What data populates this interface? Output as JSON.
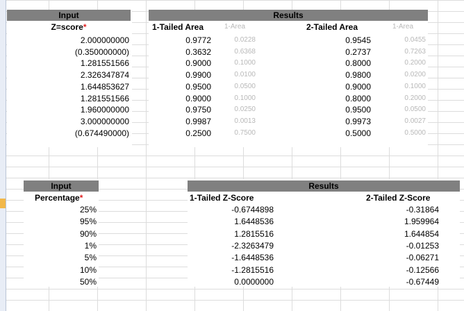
{
  "top": {
    "input_header": "Input",
    "results_header": "Results",
    "z_label": "Z=score",
    "one_tailed_label": "1-Tailed Area",
    "one_minus_label": "1-Area",
    "two_tailed_label": "2-Tailed Area",
    "two_minus_label": "1-Area",
    "required_mark": "*",
    "rows": [
      {
        "z": "2.000000000",
        "a1": "0.9772",
        "m1": "0.0228",
        "a2": "0.9545",
        "m2": "0.0455"
      },
      {
        "z": "(0.350000000)",
        "a1": "0.3632",
        "m1": "0.6368",
        "a2": "0.2737",
        "m2": "0.7263"
      },
      {
        "z": "1.281551566",
        "a1": "0.9000",
        "m1": "0.1000",
        "a2": "0.8000",
        "m2": "0.2000"
      },
      {
        "z": "2.326347874",
        "a1": "0.9900",
        "m1": "0.0100",
        "a2": "0.9800",
        "m2": "0.0200"
      },
      {
        "z": "1.644853627",
        "a1": "0.9500",
        "m1": "0.0500",
        "a2": "0.9000",
        "m2": "0.1000"
      },
      {
        "z": "1.281551566",
        "a1": "0.9000",
        "m1": "0.1000",
        "a2": "0.8000",
        "m2": "0.2000"
      },
      {
        "z": "1.960000000",
        "a1": "0.9750",
        "m1": "0.0250",
        "a2": "0.9500",
        "m2": "0.0500"
      },
      {
        "z": "3.000000000",
        "a1": "0.9987",
        "m1": "0.0013",
        "a2": "0.9973",
        "m2": "0.0027"
      },
      {
        "z": "(0.674490000)",
        "a1": "0.2500",
        "m1": "0.7500",
        "a2": "0.5000",
        "m2": "0.5000"
      }
    ]
  },
  "bottom": {
    "input_header": "Input",
    "results_header": "Results",
    "pct_label": "Percentage",
    "one_tailed_label": "1-Tailed Z-Score",
    "two_tailed_label": "2-Tailed Z-Score",
    "required_mark": "*",
    "rows": [
      {
        "p": "25%",
        "z1": "-0.6744898",
        "z2": "-0.31864"
      },
      {
        "p": "95%",
        "z1": "1.6448536",
        "z2": "1.959964"
      },
      {
        "p": "90%",
        "z1": "1.2815516",
        "z2": "1.644854"
      },
      {
        "p": "1%",
        "z1": "-2.3263479",
        "z2": "-0.01253"
      },
      {
        "p": "5%",
        "z1": "-1.6448536",
        "z2": "-0.06271"
      },
      {
        "p": "10%",
        "z1": "-1.2815516",
        "z2": "-0.12566"
      },
      {
        "p": "50%",
        "z1": "0.0000000",
        "z2": "-0.67449"
      }
    ]
  }
}
